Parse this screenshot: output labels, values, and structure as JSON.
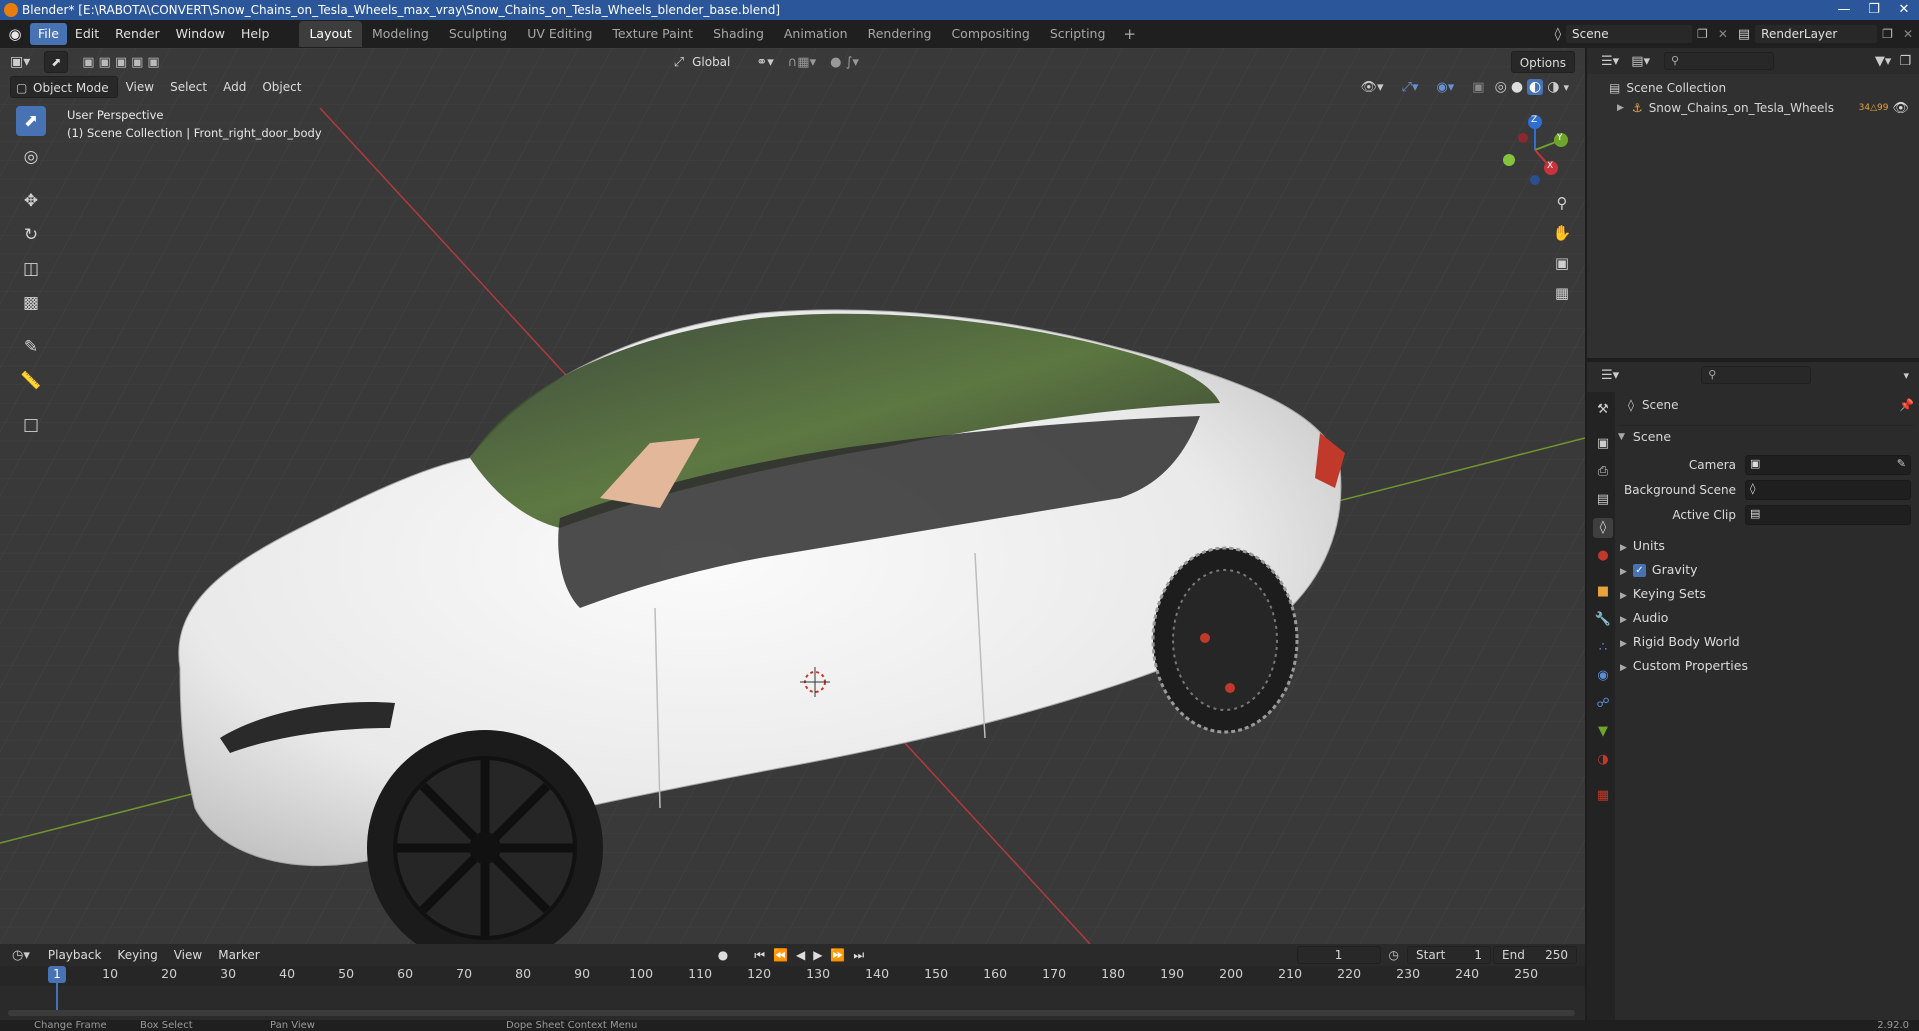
{
  "window": {
    "title": "Blender* [E:\\RABOTA\\CONVERT\\Snow_Chains_on_Tesla_Wheels_max_vray\\Snow_Chains_on_Tesla_Wheels_blender_base.blend]"
  },
  "menubar": {
    "items": [
      "File",
      "Edit",
      "Render",
      "Window",
      "Help"
    ]
  },
  "workspaces": [
    "Layout",
    "Modeling",
    "Sculpting",
    "UV Editing",
    "Texture Paint",
    "Shading",
    "Animation",
    "Rendering",
    "Compositing",
    "Scripting"
  ],
  "scene_selector": {
    "scene": "Scene",
    "view_layer": "RenderLayer"
  },
  "viewport_header": {
    "mode": "Object Mode",
    "menus": [
      "View",
      "Select",
      "Add",
      "Object"
    ],
    "transform_orientation": "Global",
    "options_label": "Options"
  },
  "viewport": {
    "perspective_label": "User Perspective",
    "context_label": "(1) Scene Collection | Front_right_door_body",
    "gizmo_axes": [
      "Z",
      "Y",
      "X"
    ]
  },
  "outliner": {
    "root_label": "Scene Collection",
    "items": [
      {
        "label": "Snow_Chains_on_Tesla_Wheels",
        "badge": "34",
        "badge2": "99"
      }
    ]
  },
  "properties": {
    "context_label": "Scene",
    "panel_title": "Scene",
    "fields": [
      {
        "label": "Camera"
      },
      {
        "label": "Background Scene"
      },
      {
        "label": "Active Clip"
      }
    ],
    "sections": [
      "Units",
      "Gravity",
      "Keying Sets",
      "Audio",
      "Rigid Body World",
      "Custom Properties"
    ],
    "gravity_checked": true
  },
  "timeline": {
    "menus": [
      "Playback",
      "Keying",
      "View",
      "Marker"
    ],
    "current_frame": "1",
    "start_label": "Start",
    "start_value": "1",
    "end_label": "End",
    "end_value": "250",
    "ruler": [
      "10",
      "20",
      "30",
      "40",
      "50",
      "60",
      "70",
      "80",
      "90",
      "100",
      "110",
      "120",
      "130",
      "140",
      "150",
      "160",
      "170",
      "180",
      "190",
      "200",
      "210",
      "220",
      "230",
      "240",
      "250"
    ],
    "ruler_current": "1"
  },
  "statusbar": {
    "items": [
      "Change Frame",
      "Box Select",
      "Pan View",
      "Dope Sheet Context Menu"
    ],
    "version": "2.92.0"
  },
  "colors": {
    "accent": "#4772b3",
    "title_bar": "#2b579a",
    "viewport_bg": "#393939",
    "axis_x": "#c9333c",
    "axis_y": "#6ea52a",
    "axis_z": "#2f6fd1"
  }
}
